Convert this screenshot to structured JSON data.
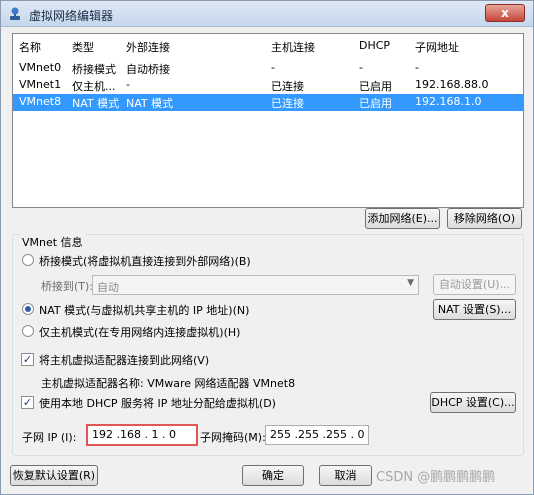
{
  "window": {
    "title": "虚拟网络编辑器",
    "close_label": "x"
  },
  "table": {
    "headers": [
      "名称",
      "类型",
      "外部连接",
      "主机连接",
      "DHCP",
      "子网地址"
    ],
    "rows": [
      [
        "VMnet0",
        "桥接模式",
        "自动桥接",
        "-",
        "-",
        "-"
      ],
      [
        "VMnet1",
        "仅主机...",
        "-",
        "已连接",
        "已启用",
        "192.168.88.0"
      ],
      [
        "VMnet8",
        "NAT 模式",
        "NAT 模式",
        "已连接",
        "已启用",
        "192.168.1.0"
      ]
    ],
    "selected_row": 2
  },
  "buttons": {
    "add_network": "添加网络(E)...",
    "remove_network": "移除网络(O)",
    "auto_settings": "自动设置(U)...",
    "nat_settings": "NAT 设置(S)...",
    "dhcp_settings": "DHCP 设置(C)...",
    "restore_defaults": "恢复默认设置(R)",
    "ok": "确定",
    "cancel": "取消"
  },
  "vmnet_info": {
    "group_title": "VMnet 信息",
    "bridge_mode": "桥接模式(将虚拟机直接连接到外部网络)(B)",
    "bridge_to_label": "桥接到(T):",
    "bridge_to_value": "自动",
    "nat_mode": "NAT 模式(与虚拟机共享主机的 IP 地址)(N)",
    "host_only_mode": "仅主机模式(在专用网络内连接虚拟机)(H)",
    "connect_adapter": "将主机虚拟适配器连接到此网络(V)",
    "adapter_name": "主机虚拟适配器名称: VMware 网络适配器 VMnet8",
    "use_dhcp": "使用本地 DHCP 服务将 IP 地址分配给虚拟机(D)",
    "subnet_ip_label": "子网 IP (I):",
    "subnet_ip_value": "192 .168 . 1 . 0",
    "subnet_mask_label": "子网掩码(M):",
    "subnet_mask_value": "255 .255 .255 . 0",
    "selected_mode": "nat",
    "connect_adapter_checked": true,
    "use_dhcp_checked": true
  },
  "watermark": "CSDN @鹏鹏鹏鹏鹏"
}
